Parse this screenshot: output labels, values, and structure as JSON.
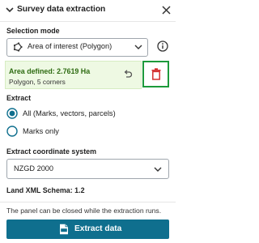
{
  "header": {
    "title": "Survey data extraction",
    "collapse_icon": "chevron-down-icon",
    "close_icon": "close-icon"
  },
  "selection_mode": {
    "label": "Selection mode",
    "selected": "Area of interest (Polygon)",
    "icon": "polygon-icon",
    "info_icon": "info-icon"
  },
  "area": {
    "title": "Area defined: 2.7619 Ha",
    "detail": "Polygon, 5 corners",
    "undo_icon": "undo-icon",
    "delete_icon": "trash-icon"
  },
  "extract": {
    "label": "Extract",
    "options": [
      {
        "label": "All (Marks, vectors, parcels)",
        "selected": true
      },
      {
        "label": "Marks only",
        "selected": false
      }
    ]
  },
  "coordinate_system": {
    "label": "Extract coordinate system",
    "selected": "NZGD 2000"
  },
  "schema": {
    "label": "Land XML Schema: 1.2"
  },
  "note": "The panel can be closed while the extraction runs.",
  "extract_button": {
    "label": "Extract data",
    "icon": "xml-file-icon"
  },
  "colors": {
    "primary": "#0f6f8e",
    "success_bg": "#eef9e3",
    "success_text": "#2e6b12",
    "delete_red": "#d32f2f",
    "highlight_border": "#1c9a3a"
  }
}
